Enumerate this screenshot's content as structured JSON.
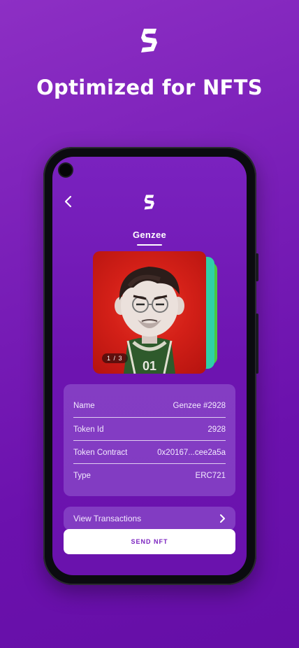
{
  "headline": "Optimized for NFTS",
  "icons": {
    "brand": "s-logo-icon",
    "back": "chevron-left-icon",
    "forward": "chevron-right-icon"
  },
  "colors": {
    "accent": "#7a22bf",
    "card_red": "#d42018",
    "card_teal": "#2fd0a8",
    "card_green": "#4cc642",
    "white": "#ffffff"
  },
  "nft": {
    "collection": "Genzee",
    "counter": "1 / 3",
    "jersey_number": "01"
  },
  "details": [
    {
      "label": "Name",
      "value": "Genzee #2928"
    },
    {
      "label": "Token Id",
      "value": "2928"
    },
    {
      "label": "Token Contract",
      "value": "0x20167...cee2a5a"
    },
    {
      "label": "Type",
      "value": "ERC721"
    }
  ],
  "actions": {
    "view_transactions": "View Transactions",
    "send_nft": "SEND NFT"
  }
}
